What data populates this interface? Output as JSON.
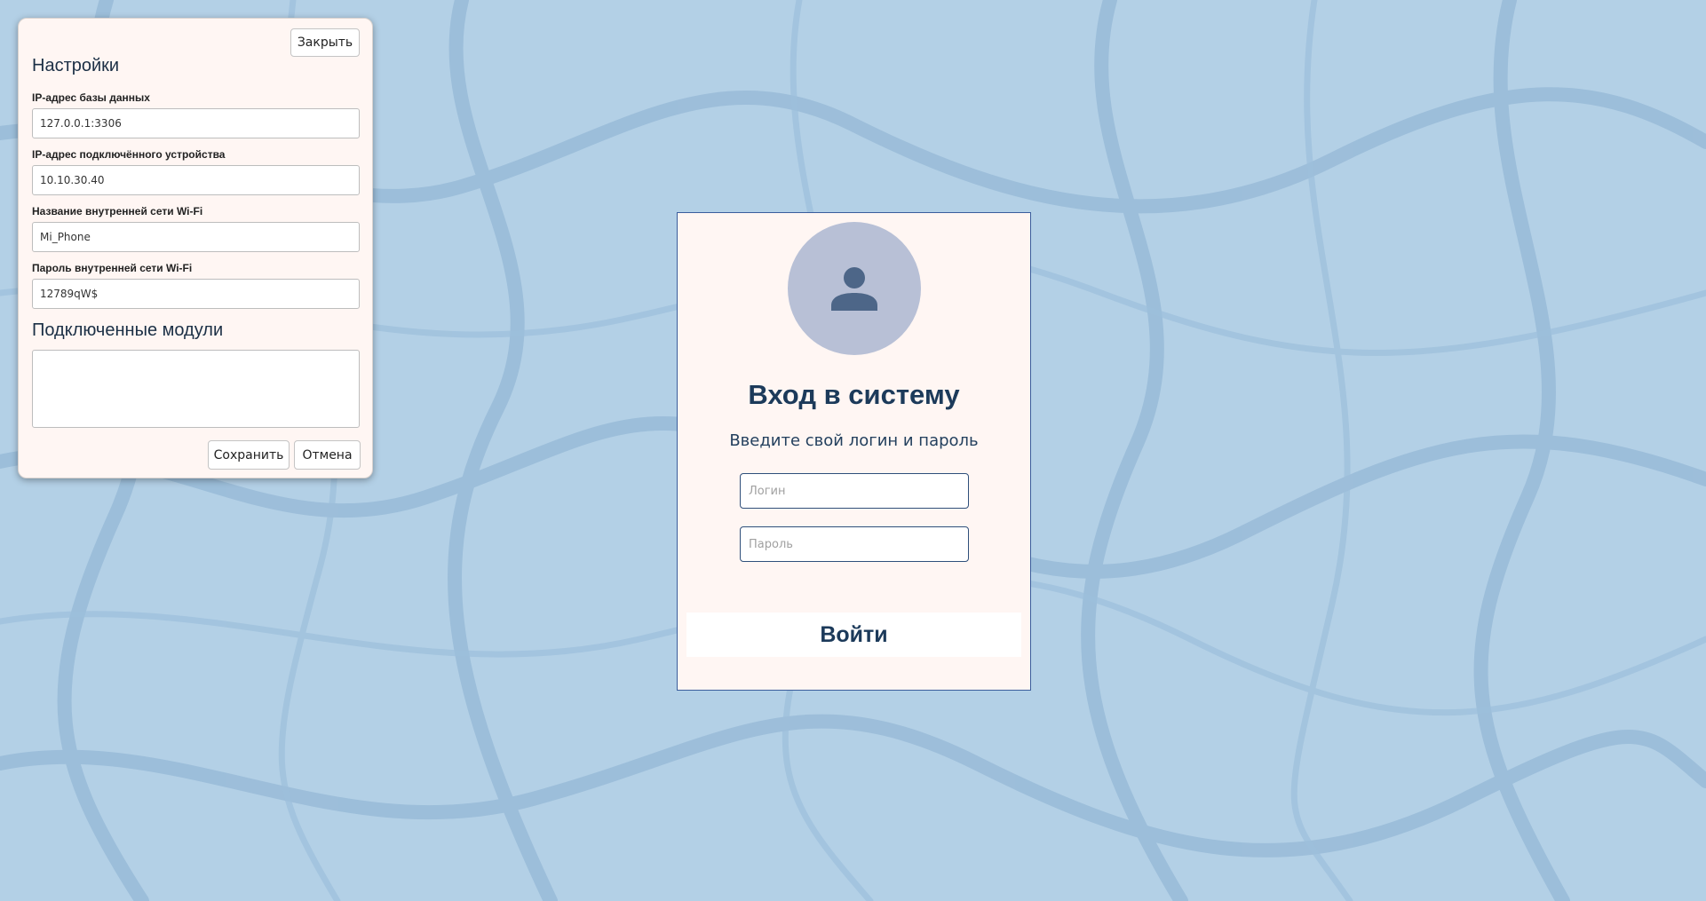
{
  "settings": {
    "close_label": "Закрыть",
    "title": "Настройки",
    "fields": [
      {
        "label": "IP-адрес базы данных",
        "value": "127.0.0.1:3306"
      },
      {
        "label": "IP-адрес подключённого устройства",
        "value": "10.10.30.40"
      },
      {
        "label": "Название внутренней сети Wi-Fi",
        "value": "Mi_Phone"
      },
      {
        "label": "Пароль внутренней сети Wi-Fi",
        "value": "12789qW$"
      }
    ],
    "modules_title": "Подключенные модули",
    "modules_value": "",
    "save_label": "Сохранить",
    "cancel_label": "Отмена"
  },
  "login": {
    "avatar_icon": "user-icon",
    "title": "Вход в систему",
    "subtitle": "Введите свой логин и пароль",
    "login_placeholder": "Логин",
    "password_placeholder": "Пароль",
    "submit_label": "Войти"
  },
  "colors": {
    "background": "#b3d0e6",
    "panel": "#fff6f3",
    "accent": "#1c3a5a",
    "avatar_bg": "#b8c0d6",
    "avatar_fg": "#4d6688"
  }
}
